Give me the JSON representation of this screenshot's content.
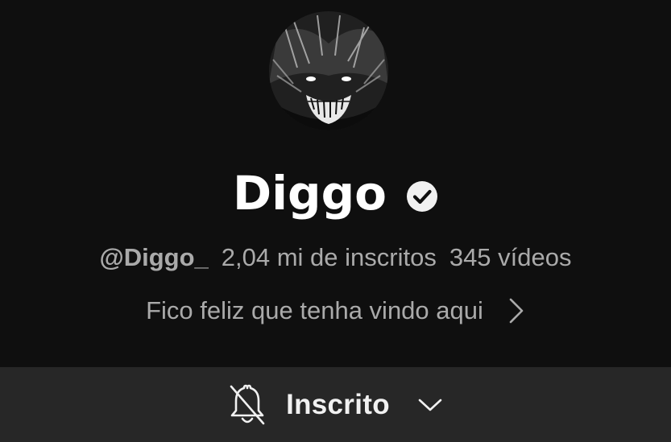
{
  "channel": {
    "name": "Diggo",
    "verified": true,
    "handle": "@Diggo_",
    "subscribers": "2,04 mi de inscritos",
    "videos": "345 vídeos",
    "description": "Fico feliz que tenha vindo aqui"
  },
  "subscribe_button": {
    "label": "Inscrito",
    "bell_icon": "bell-off-icon",
    "chevron_icon": "chevron-down-icon"
  },
  "icons": {
    "verified": "verified-check-icon",
    "description_chevron": "chevron-right-icon"
  },
  "colors": {
    "background": "#0f0f0f",
    "bar": "#272727",
    "secondary_text": "#aaaaaa",
    "primary_text": "#ffffff"
  }
}
